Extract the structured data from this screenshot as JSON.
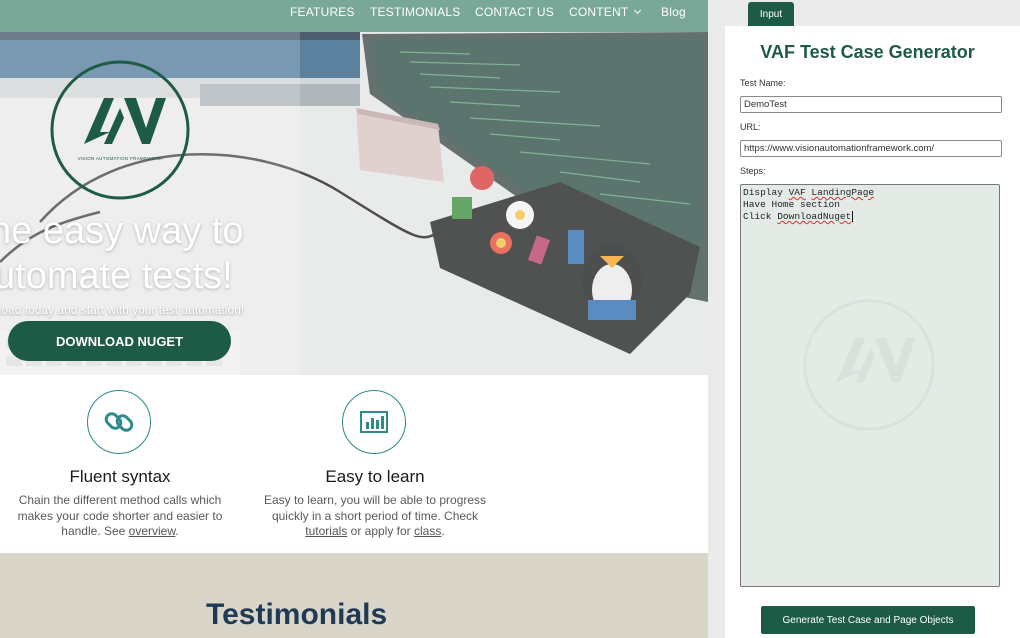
{
  "nav": {
    "items": [
      "FEATURES",
      "TESTIMONIALS",
      "CONTACT US",
      "CONTENT",
      "Blog"
    ]
  },
  "hero": {
    "logo_text": "VISION AUTOMATION FRAMEWORK",
    "line1": "he easy way  to",
    "line2": "utomate tests!",
    "subtitle": "nload today and start with your test automation!",
    "download_button": "DOWNLOAD NUGET"
  },
  "features": [
    {
      "icon": "chain-link-icon",
      "title": "Fluent syntax",
      "desc_line1": "Chain the different method calls which",
      "desc_line2": "makes your code shorter and easier to",
      "desc_prefix": "handle. See ",
      "desc_link": "overview",
      "desc_suffix": "."
    },
    {
      "icon": "bar-chart-icon",
      "title": "Easy to learn",
      "desc_line1": "Easy to learn, you will be able to progress",
      "desc_line2": "quickly in a short period of time. Check",
      "desc_link1": "tutorials",
      "desc_mid": " or apply for ",
      "desc_link2": "class",
      "desc_suffix": "."
    }
  ],
  "testimonials": {
    "title": "Testimonials"
  },
  "extension": {
    "tab_label": "Input",
    "title": "VAF Test Case Generator",
    "test_name_label": "Test Name:",
    "test_name_value": "DemoTest",
    "url_label": "URL:",
    "url_value": "https://www.visionautomationframework.com/",
    "steps_label": "Steps:",
    "steps": {
      "line1_a": "Display ",
      "line1_b": "VAF",
      "line1_c": " ",
      "line1_d": "LandingPage",
      "line2": "Have Home section",
      "line3_a": "Click ",
      "line3_b": "DownloadNuget"
    },
    "generate_button": "Generate Test Case and Page Objects"
  },
  "colors": {
    "brand_green": "#1e5b47",
    "nav_green": "#79a898",
    "testimonials_bg": "#d9d5c9",
    "heading_navy": "#1f3a54",
    "icon_teal": "#2f8a8a"
  }
}
